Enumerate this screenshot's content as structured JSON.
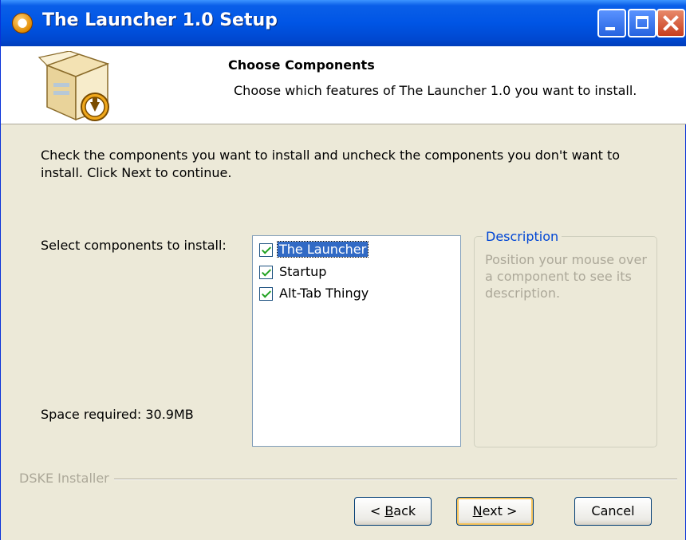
{
  "window": {
    "title": "The Launcher 1.0 Setup"
  },
  "header": {
    "title": "Choose Components",
    "subtitle": "Choose which features of The Launcher 1.0 you want to install."
  },
  "body": {
    "instructions": "Check the components you want to install and uncheck the components you don't want to install. Click Next to continue.",
    "select_label": "Select components to install:",
    "space_required": "Space required: 30.9MB"
  },
  "components": [
    {
      "label": "The Launcher",
      "checked": true,
      "selected": true
    },
    {
      "label": "Startup",
      "checked": true,
      "selected": false
    },
    {
      "label": "Alt-Tab Thingy",
      "checked": true,
      "selected": false
    }
  ],
  "description": {
    "legend": "Description",
    "text": "Position your mouse over a component to see its description."
  },
  "footer": {
    "branding": "DSKE Installer",
    "back_prefix": "< ",
    "back_key": "B",
    "back_rest": "ack",
    "next_key": "N",
    "next_rest": "ext >",
    "cancel_label": "Cancel"
  },
  "colors": {
    "titlebar": "#0055E5",
    "selection": "#316AC5",
    "check": "#21A121",
    "description_legend": "#0046D5",
    "disabled_text": "#ACA899"
  }
}
